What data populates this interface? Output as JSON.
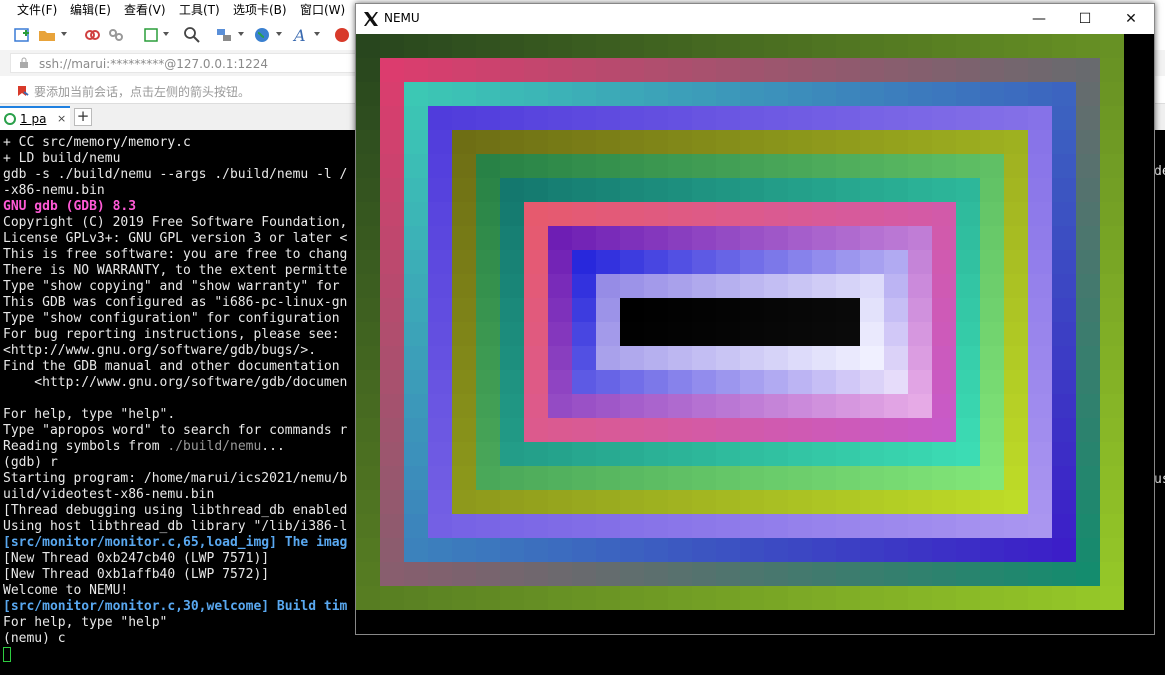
{
  "xshell": {
    "menu": [
      "文件(F)",
      "编辑(E)",
      "查看(V)",
      "工具(T)",
      "选项卡(B)",
      "窗口(W)"
    ],
    "address": "ssh://marui:*********@127.0.0.1:1224",
    "hint": "要添加当前会话，点击左侧的箭头按钮。",
    "tab_label": "1 pa",
    "tab_close": "×",
    "tab_add": "+",
    "terminal_lines": [
      {
        "text": "+ CC src/memory/memory.c"
      },
      {
        "text": "+ LD build/nemu"
      },
      {
        "text": "gdb -s ./build/nemu --args ./build/nemu -l /"
      },
      {
        "text": "-x86-nemu.bin"
      },
      {
        "text": "GNU gdb (GDB) 8.3",
        "cls": "c-mag"
      },
      {
        "text": "Copyright (C) 2019 Free Software Foundation,"
      },
      {
        "text": "License GPLv3+: GNU GPL version 3 or later <"
      },
      {
        "text": "This is free software: you are free to chang"
      },
      {
        "text": "There is NO WARRANTY, to the extent permitte"
      },
      {
        "text": "Type \"show copying\" and \"show warranty\" for"
      },
      {
        "text": "This GDB was configured as \"i686-pc-linux-gn"
      },
      {
        "text": "Type \"show configuration\" for configuration"
      },
      {
        "text": "For bug reporting instructions, please see:"
      },
      {
        "text": "<http://www.gnu.org/software/gdb/bugs/>."
      },
      {
        "text": "Find the GDB manual and other documentation"
      },
      {
        "text": "    <http://www.gnu.org/software/gdb/documen"
      },
      {
        "text": ""
      },
      {
        "text": "For help, type \"help\"."
      },
      {
        "text": "Type \"apropos word\" to search for commands r"
      },
      {
        "text": "Reading symbols from ",
        "extra": "./build/nemu",
        "tail": "..."
      },
      {
        "text": "(gdb) r"
      },
      {
        "text": "Starting program: /home/marui/ics2021/nemu/b"
      },
      {
        "text": "uild/videotest-x86-nemu.bin"
      },
      {
        "text": "[Thread debugging using libthread_db enabled"
      },
      {
        "text": "Using host libthread_db library \"/lib/i386-l"
      },
      {
        "text": "[src/monitor/monitor.c,65,load_img] The imag",
        "cls": "c-blue"
      },
      {
        "text": "[New Thread 0xb247cb40 (LWP 7571)]"
      },
      {
        "text": "[New Thread 0xb1affb40 (LWP 7572)]"
      },
      {
        "text": "Welcome to NEMU!"
      },
      {
        "text": "[src/monitor/monitor.c,30,welcome] Build tim",
        "cls": "c-blue"
      },
      {
        "text": "For help, type \"help\""
      },
      {
        "text": "(nemu) c"
      }
    ],
    "terminal_right": [
      "de",
      "us"
    ]
  },
  "nemu": {
    "title": "NEMU",
    "minimize": "—",
    "maximize": "☐",
    "close": "✕"
  }
}
